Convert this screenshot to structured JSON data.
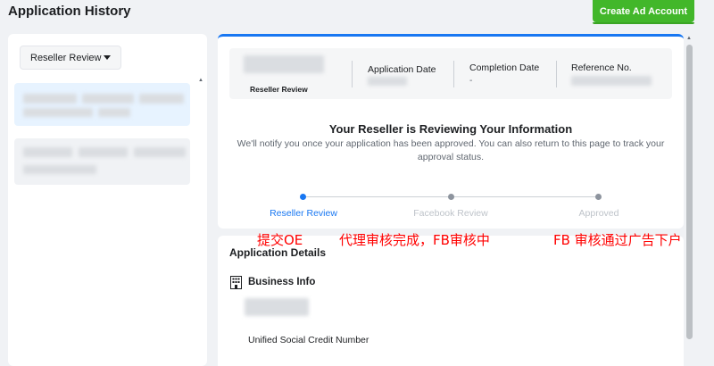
{
  "header": {
    "title": "Application History",
    "create_button_label": "Create Ad Account"
  },
  "sidebar": {
    "filter_label": "Reseller Review",
    "scroll_up_glyph": "▲"
  },
  "application": {
    "status_sub": "Reseller Review",
    "columns": [
      {
        "label": "Application Date",
        "value": ""
      },
      {
        "label": "Completion Date",
        "value": "-"
      },
      {
        "label": "Reference No.",
        "value": ""
      }
    ],
    "heading": "Your Reseller is Reviewing Your Information",
    "description": "We'll notify you once your application has been approved. You can also return to this page to track your approval status.",
    "steps": [
      {
        "label": "Reseller Review",
        "state": "active"
      },
      {
        "label": "Facebook Review",
        "state": "pending"
      },
      {
        "label": "Approved",
        "state": "pending"
      }
    ]
  },
  "annotations": [
    "提交OE",
    "代理审核完成，FB审核中",
    "FB 审核通过广告下户"
  ],
  "details": {
    "title": "Application Details",
    "section_title": "Business Info",
    "field_label": "Unified Social Credit Number"
  },
  "colors": {
    "accent_blue": "#1877f2",
    "create_green": "#42b72a",
    "annotation_red": "#ff0000",
    "step_pending": "#8d949e"
  },
  "icons": {
    "dropdown": "caret-down-icon",
    "business": "building-icon"
  }
}
